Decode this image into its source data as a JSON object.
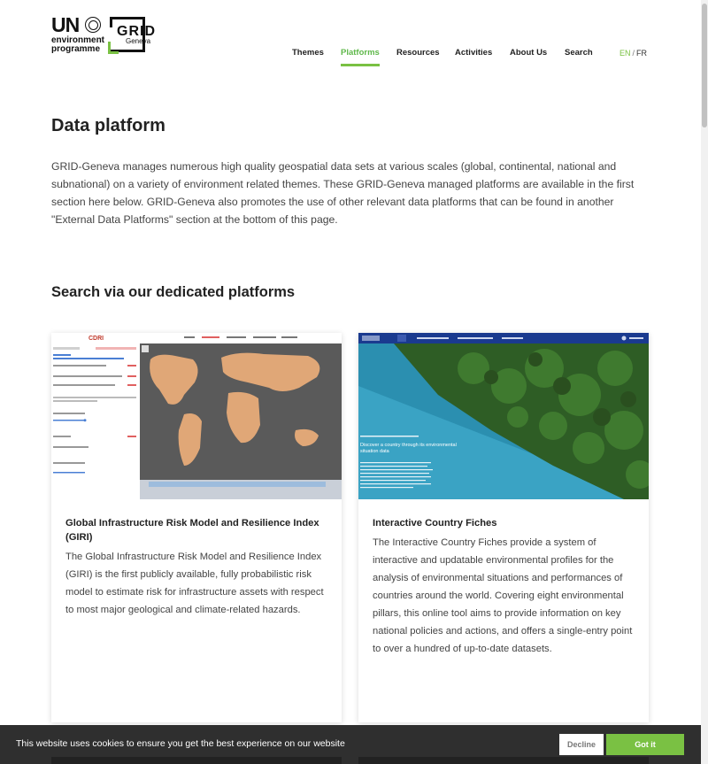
{
  "logo": {
    "un": "UN",
    "environment": "environment",
    "programme": "programme",
    "grid": "GRID",
    "geneva": "Geneva"
  },
  "nav": {
    "items": [
      {
        "label": "Themes"
      },
      {
        "label": "Platforms"
      },
      {
        "label": "Resources"
      },
      {
        "label": "Activities"
      },
      {
        "label": "About Us"
      },
      {
        "label": "Search"
      }
    ],
    "active": "Platforms",
    "accent_color": "#7ac143"
  },
  "lang": {
    "en": "EN",
    "separator": "/",
    "fr": "FR"
  },
  "main": {
    "title": "Data platform",
    "intro": "GRID-Geneva manages numerous high quality geospatial data sets at various scales (global, continental, national and subnational) on a variety of environment related themes. These GRID-Geneva managed platforms are available in the first section here below. GRID-Geneva also promotes the use of other relevant data platforms that can be found in another \"External Data Platforms\" section at the bottom of this page.",
    "section_title": "Search via our dedicated platforms"
  },
  "cards": [
    {
      "title": "Global Infrastructure Risk Model and Resilience Index (GIRI)",
      "description": "The Global Infrastructure Risk Model and Resilience Index (GIRI) is the first publicly available, fully probabilistic risk model to estimate risk for infrastructure assets with respect to most major geological and climate-related hazards.",
      "image_logo": "CDRI"
    },
    {
      "title": "Interactive Country Fiches",
      "description": "The Interactive Country Fiches provide a system of interactive and updatable environmental profiles for the analysis of environmental situations and performances of countries around the world. Covering eight environmental pillars, this online tool aims to provide information on key national policies and actions, and offers a single-entry point to over a hundred of up-to-date datasets.",
      "image_caption": "Discover a country through its environmental situation data"
    }
  ],
  "cookie": {
    "text": "This website uses cookies to ensure you get the best experience on our website",
    "decline": "Decline",
    "accept": "Got it"
  }
}
